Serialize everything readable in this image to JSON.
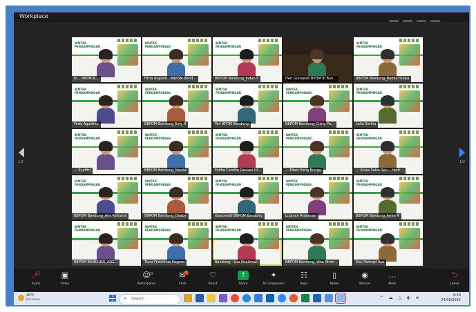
{
  "window": {
    "title": "Workplace"
  },
  "nav": {
    "page_left": "1/2",
    "page_right": "1/2"
  },
  "banner_text": "BIMTEK PENDAMPINGAN",
  "participants": [
    {
      "name": "Ki... BPOM B..."
    },
    {
      "name": "Fitria Augusti...BBPOM Band..."
    },
    {
      "name": "BBPOM Bandung_Indah F"
    },
    {
      "name": "Heri Gunawan BPOM di Ban..."
    },
    {
      "name": "BBPOM Bandung_Nadila Hulwa"
    },
    {
      "name": "Firda Agustina"
    },
    {
      "name": "BBPOM Bandung_Esty R"
    },
    {
      "name": "Teri BPOM Bandung"
    },
    {
      "name": "BBPOM Bandung_Clisty Pu..."
    },
    {
      "name": "Laila Sorina"
    },
    {
      "name": "... Syafitri"
    },
    {
      "name": "BBPOM Bandung_Nanda"
    },
    {
      "name": "Fatika Cantika Reniani Hi..."
    },
    {
      "name": "... Eliani Kang Bunga"
    },
    {
      "name": "... Anisa Salsa Sen... Herti..."
    },
    {
      "name": "BBPOM Bandung_Aini Rahuma"
    },
    {
      "name": "BBPOM Bandung_Dodoy"
    },
    {
      "name": "Gasamedi BBPOM Bandung"
    },
    {
      "name": "Lugiyan Ardancan"
    },
    {
      "name": "BBPOM Bandung_Arnie R"
    },
    {
      "name": "BBPOM BANDUNG_ADZ..."
    },
    {
      "name": "Tiara Fridolinda Nagrea"
    },
    {
      "name": "Bandung - Luu Khatimah"
    },
    {
      "name": "BBPOM Bandung_Vitia Nirmi..."
    },
    {
      "name": "Erly Dwicayi Ayu"
    }
  ],
  "toolbar": {
    "audio": {
      "label": "Audio",
      "icon": "mic-muted-icon"
    },
    "video": {
      "label": "Video",
      "icon": "camera-icon"
    },
    "participants": {
      "label": "Participants",
      "count": "35",
      "icon": "people-icon"
    },
    "chat": {
      "label": "Chat",
      "badge": "5",
      "icon": "chat-icon"
    },
    "react": {
      "label": "React",
      "icon": "heart-icon"
    },
    "share": {
      "label": "Share",
      "icon": "share-arrow-icon"
    },
    "ai_companion": {
      "label": "AI Companion",
      "icon": "sparkle-icon"
    },
    "apps": {
      "label": "Apps",
      "icon": "apps-icon"
    },
    "notes": {
      "label": "Notes",
      "icon": "notes-icon"
    },
    "record": {
      "label": "Record",
      "icon": "record-icon"
    },
    "more": {
      "label": "More",
      "icon": "more-icon"
    },
    "leave": {
      "label": "Leave",
      "icon": "leave-icon"
    }
  },
  "taskbar": {
    "weather_temp": "29°C",
    "weather_cond": "Berawan",
    "search_placeholder": "Search",
    "time": "9:56",
    "date": "24/09/2025"
  },
  "colors": {
    "accent": "#2d8cff",
    "share": "#0e9f4a",
    "danger": "#e0352b",
    "frame": "#4a7fc8"
  }
}
